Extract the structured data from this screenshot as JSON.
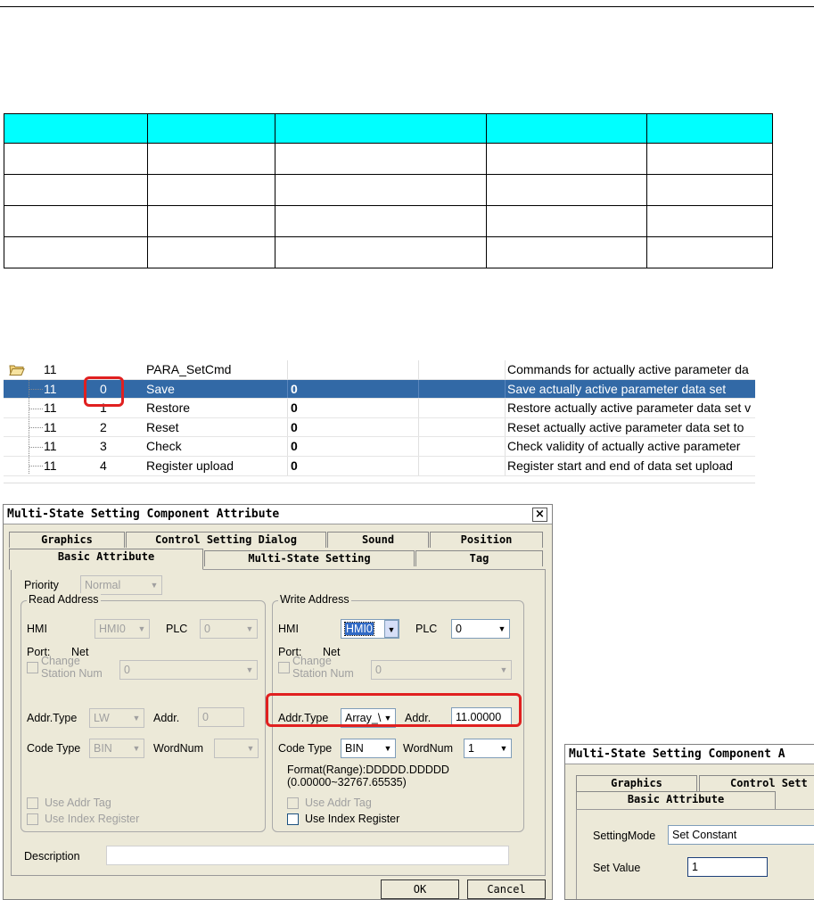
{
  "doc_table": {
    "header_color": "#00ffff",
    "columns": [
      "",
      "",
      "",
      "",
      ""
    ],
    "rows": [
      [
        "",
        "",
        "",
        "",
        ""
      ],
      [
        "",
        "",
        "",
        "",
        ""
      ],
      [
        "",
        "",
        "",
        "",
        ""
      ],
      [
        "",
        "",
        "",
        "",
        ""
      ]
    ]
  },
  "param_list": {
    "selected_color": "#3269a6",
    "rows": [
      {
        "col1": "11",
        "col2": "",
        "col3": "PARA_SetCmd",
        "col4": "",
        "col5": "Commands for actually active parameter da",
        "is_folder": true
      },
      {
        "col1": "11",
        "col2": "0",
        "col3": "Save",
        "col4": "0",
        "col5": "Save actually active parameter data set",
        "selected": true
      },
      {
        "col1": "11",
        "col2": "1",
        "col3": "Restore",
        "col4": "0",
        "col5": "Restore actually active parameter data set v"
      },
      {
        "col1": "11",
        "col2": "2",
        "col3": "Reset",
        "col4": "0",
        "col5": "Reset actually active parameter data set to"
      },
      {
        "col1": "11",
        "col2": "3",
        "col3": "Check",
        "col4": "0",
        "col5": "Check validity of  actually active parameter"
      },
      {
        "col1": "11",
        "col2": "4",
        "col3": "Register upload",
        "col4": "0",
        "col5": "Register start and end of data set upload"
      }
    ]
  },
  "dialog": {
    "title": "Multi-State Setting Component Attribute",
    "close_glyph": "×",
    "tabs_row1": [
      "Graphics",
      "Control Setting Dialog",
      "Sound",
      "Position"
    ],
    "tabs_row2": [
      "Basic Attribute",
      "Multi-State Setting",
      "Tag"
    ],
    "priority_label": "Priority",
    "priority_value": "Normal",
    "read": {
      "group_label": "Read Address",
      "hmi_label": "HMI",
      "hmi_value": "HMI0",
      "plc_label": "PLC",
      "plc_value": "0",
      "port_label": "Port:",
      "port_value": "Net",
      "change_station_line1": "Change",
      "change_station_line2": "Station Num",
      "station_value": "0",
      "addr_type_label": "Addr.Type",
      "addr_type_value": "LW",
      "addr_label": "Addr.",
      "addr_value": "0",
      "code_type_label": "Code Type",
      "code_type_value": "BIN",
      "wordnum_label": "WordNum",
      "wordnum_value": "",
      "use_addr_tag": "Use Addr Tag",
      "use_index_register": "Use Index Register"
    },
    "write": {
      "group_label": "Write Address",
      "hmi_label": "HMI",
      "hmi_value": "HMI0",
      "plc_label": "PLC",
      "plc_value": "0",
      "port_label": "Port:",
      "port_value": "Net",
      "change_station_line1": "Change",
      "change_station_line2": "Station Num",
      "station_value": "0",
      "addr_type_label": "Addr.Type",
      "addr_type_value": "Array_\\",
      "addr_label": "Addr.",
      "addr_value": "11.00000",
      "code_type_label": "Code Type",
      "code_type_value": "BIN",
      "wordnum_label": "WordNum",
      "wordnum_value": "1",
      "format_line1": "Format(Range):DDDDD.DDDDD",
      "format_line2": "(0.00000~32767.65535)",
      "use_addr_tag": "Use Addr Tag",
      "use_index_register": "Use Index Register"
    },
    "description_label": "Description",
    "description_value": "",
    "ok_label": "OK",
    "cancel_label": "Cancel"
  },
  "dialog2": {
    "title": "Multi-State Setting Component A",
    "tabs_row1": [
      "Graphics",
      "Control Sett"
    ],
    "tabs_row2": [
      "Basic Attribute"
    ],
    "setting_mode_label": "SettingMode",
    "setting_mode_value": "Set Constant",
    "set_value_label": "Set Value",
    "set_value_value": "1"
  },
  "highlight_color": "#e02020"
}
